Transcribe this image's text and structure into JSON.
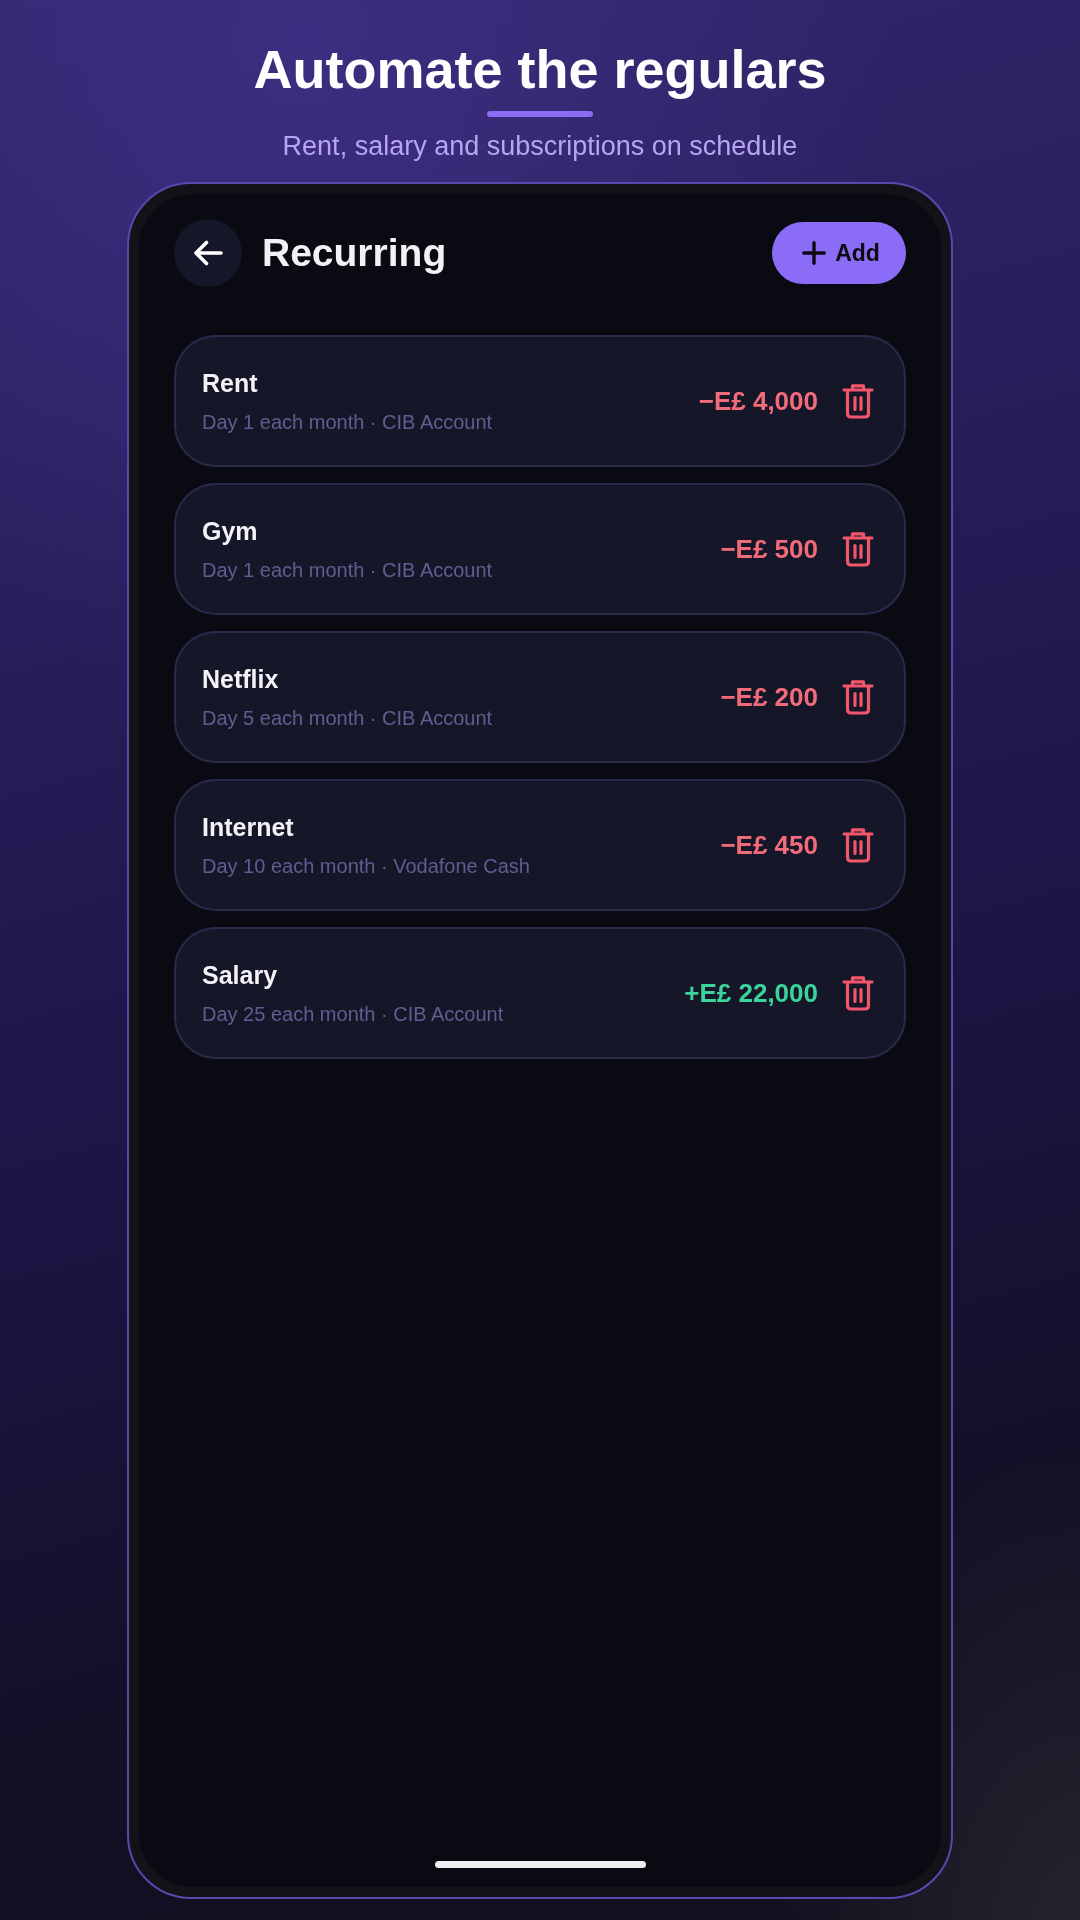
{
  "promo": {
    "title": "Automate the regulars",
    "subtitle": "Rent, salary and subscriptions on schedule"
  },
  "screen": {
    "title": "Recurring",
    "add_button": "Add"
  },
  "recurring": [
    {
      "name": "Rent",
      "schedule": "Day 1 each month · CIB Account",
      "amount": "−E£ 4,000",
      "kind": "expense"
    },
    {
      "name": "Gym",
      "schedule": "Day 1 each month · CIB Account",
      "amount": "−E£ 500",
      "kind": "expense"
    },
    {
      "name": "Netflix",
      "schedule": "Day 5 each month · CIB Account",
      "amount": "−E£ 200",
      "kind": "expense"
    },
    {
      "name": "Internet",
      "schedule": "Day 10 each month · Vodafone Cash",
      "amount": "−E£ 450",
      "kind": "expense"
    },
    {
      "name": "Salary",
      "schedule": "Day 25 each month · CIB Account",
      "amount": "+E£ 22,000",
      "kind": "income"
    }
  ]
}
